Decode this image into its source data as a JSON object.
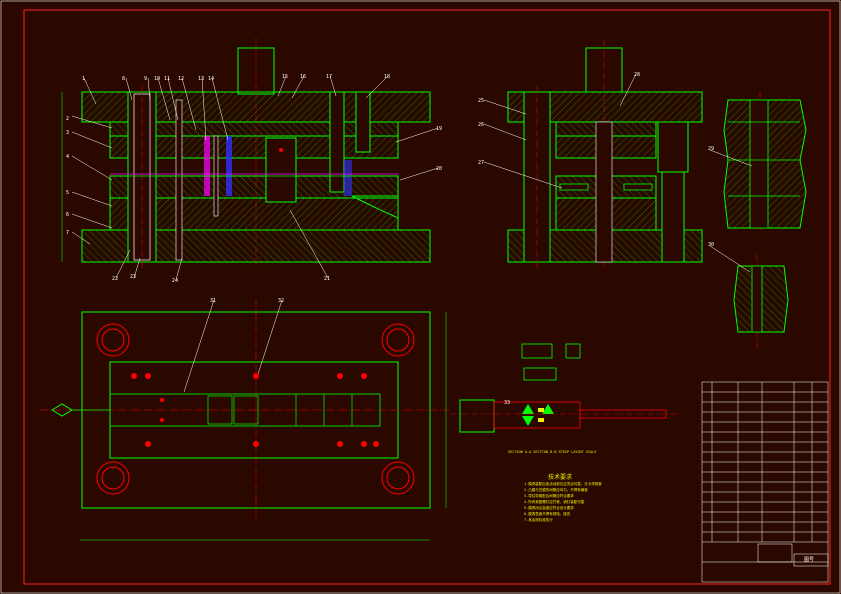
{
  "drawing": {
    "section_note": "SECTION A-A  SECTION B-B  STRIP LAYOUT  SCALE",
    "tech_requirements_title": "技术要求",
    "tech_requirements": [
      "1.模具装配后各活动部位应灵活可靠，无卡滞现象",
      "2.凸模与凹模的间隙应均匀，不得有偏差",
      "3.导柱导套配合间隙应符合要求",
      "4.所有紧固螺钉应拧紧，销钉装配可靠",
      "5.模具闭合高度应符合设计要求",
      "6.模具表面不得有锈蚀、碰伤",
      "7.其余按标准执行"
    ],
    "part_numbers_main": [
      "1",
      "2",
      "3",
      "4",
      "5",
      "6",
      "7",
      "8",
      "9",
      "10",
      "11",
      "12",
      "13",
      "14",
      "15",
      "16",
      "17",
      "18",
      "19",
      "20",
      "21",
      "22",
      "23",
      "24",
      "25",
      "26",
      "27",
      "28",
      "29",
      "30",
      "31",
      "32",
      "33"
    ],
    "title_block_label": "图号"
  },
  "colors": {
    "background": "#2a0800",
    "outline": "#00ff00",
    "hatch": "#00ff00",
    "centerline": "#ff0000",
    "dimension": "#ffffff",
    "highlight": "#ff00ff",
    "accent_yellow": "#f0f000",
    "accent_blue": "#3030ff",
    "border": "#ff2020"
  }
}
